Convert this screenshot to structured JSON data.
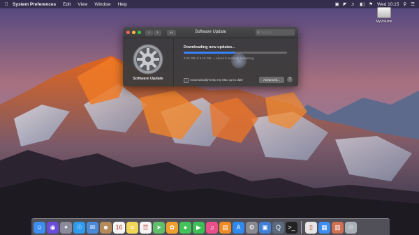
{
  "menubar": {
    "app_name": "System Preferences",
    "menus": [
      "Edit",
      "View",
      "Window",
      "Help"
    ],
    "clock": "Wed 10:15"
  },
  "desktop": {
    "drive_label": "MyVolume"
  },
  "window": {
    "title": "Software Update",
    "search_placeholder": "Search",
    "pane_label": "Software Update",
    "status": "Downloading new updates...",
    "detail": "3.04 GB of 6.10 GB — About 8 seconds remaining",
    "progress_percent": 50,
    "auto_update_label": "Automatically keep my Mac up to date",
    "auto_update_checked": false,
    "advanced_label": "Advanced...",
    "help_label": "?",
    "back_label": "‹",
    "forward_label": "›",
    "grid_label": "☷"
  },
  "dock": {
    "apps": [
      {
        "name": "finder",
        "glyph": "☺",
        "color": "#3d8ef0"
      },
      {
        "name": "siri",
        "glyph": "◉",
        "color": "#6a4dd8"
      },
      {
        "name": "launchpad",
        "glyph": "✦",
        "color": "#8a8a9a"
      },
      {
        "name": "safari",
        "glyph": "☉",
        "color": "#2d9cf0"
      },
      {
        "name": "mail",
        "glyph": "✉",
        "color": "#4a8ad8"
      },
      {
        "name": "contacts",
        "glyph": "☻",
        "color": "#b58a5a"
      },
      {
        "name": "calendar",
        "glyph": "16",
        "color": "#f4f4f4"
      },
      {
        "name": "notes",
        "glyph": "≡",
        "color": "#f2d65a"
      },
      {
        "name": "reminders",
        "glyph": "☰",
        "color": "#f4f4f4"
      },
      {
        "name": "maps",
        "glyph": "➤",
        "color": "#5fbf6a"
      },
      {
        "name": "photos",
        "glyph": "✿",
        "color": "#f0a030"
      },
      {
        "name": "messages",
        "glyph": "●",
        "color": "#44c25a"
      },
      {
        "name": "facetime",
        "glyph": "▶",
        "color": "#3cbf55"
      },
      {
        "name": "itunes",
        "glyph": "♫",
        "color": "#e8508a"
      },
      {
        "name": "ibooks",
        "glyph": "▤",
        "color": "#f08a24"
      },
      {
        "name": "app-store",
        "glyph": "A",
        "color": "#2f8af0"
      },
      {
        "name": "system-preferences",
        "glyph": "⚙",
        "color": "#8a8a90"
      },
      {
        "name": "keynote",
        "glyph": "▣",
        "color": "#3f7fd8"
      },
      {
        "name": "quicktime",
        "glyph": "Q",
        "color": "#5a6b80"
      },
      {
        "name": "terminal",
        "glyph": ">_",
        "color": "#222"
      }
    ],
    "docs": [
      {
        "name": "document",
        "glyph": "▯",
        "color": "#e6e6e6"
      },
      {
        "name": "downloads-stack",
        "glyph": "▦",
        "color": "#3d8ef0"
      },
      {
        "name": "image-stack",
        "glyph": "▥",
        "color": "#d07050"
      },
      {
        "name": "trash",
        "glyph": "♲",
        "color": "#aab0b8"
      }
    ]
  }
}
